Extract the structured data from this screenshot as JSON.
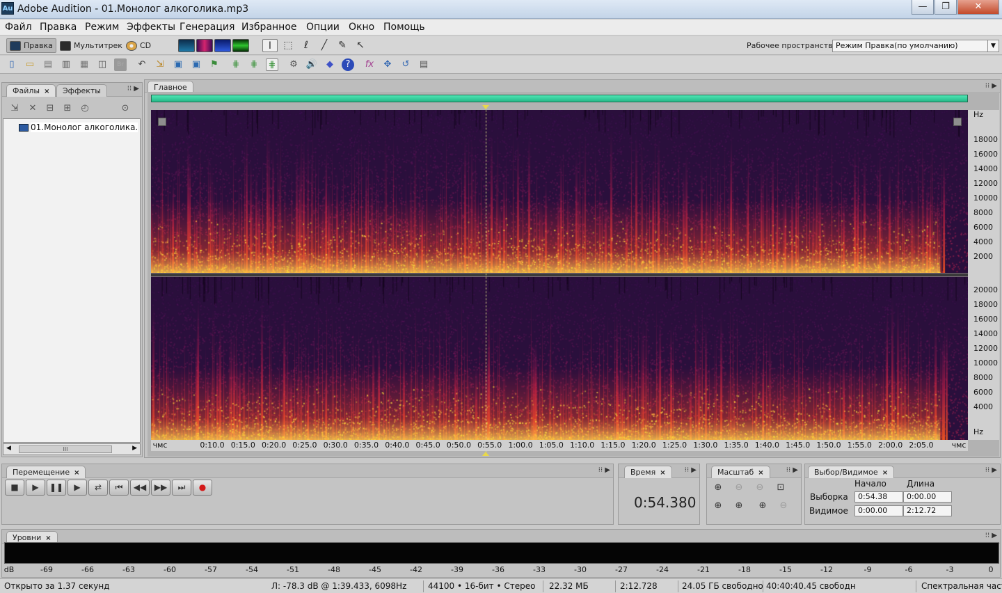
{
  "window": {
    "app_icon": "Au",
    "title": "Adobe Audition - 01.Монолог алкоголика.mp3",
    "buttons": {
      "minimize": "—",
      "maximize": "❐",
      "close": "✕"
    }
  },
  "menu": [
    "Файл",
    "Правка",
    "Режим",
    "Эффекты",
    "Генерация",
    "Избранное",
    "Опции",
    "Окно",
    "Помощь"
  ],
  "toolbar1": {
    "modes": [
      "Правка",
      "Мультитрек",
      "CD"
    ],
    "workspace_label": "Рабочее пространство:",
    "workspace_value": "Режим Правка(по умолчанию)"
  },
  "files_panel": {
    "tabs": [
      "Файлы",
      "Эффекты"
    ],
    "close": "×",
    "file_name": "01.Монолог алкоголика.",
    "scroll_grip": "III",
    "scroll_left": "◀",
    "scroll_right": "▶"
  },
  "main_panel": {
    "tab": "Главное"
  },
  "spectrogram": {
    "top_channel_labels": [
      "Hz",
      "18000",
      "16000",
      "14000",
      "12000",
      "10000",
      "8000",
      "6000",
      "4000",
      "2000"
    ],
    "bottom_channel_labels": [
      "20000",
      "18000",
      "16000",
      "14000",
      "12000",
      "10000",
      "8000",
      "6000",
      "4000",
      "Hz"
    ],
    "time_labels": [
      "чмс",
      "0:10.0",
      "0:15.0",
      "0:20.0",
      "0:25.0",
      "0:30.0",
      "0:35.0",
      "0:40.0",
      "0:45.0",
      "0:50.0",
      "0:55.0",
      "1:00.0",
      "1:05.0",
      "1:10.0",
      "1:15.0",
      "1:20.0",
      "1:25.0",
      "1:30.0",
      "1:35.0",
      "1:40.0",
      "1:45.0",
      "1:50.0",
      "1:55.0",
      "2:00.0",
      "2:05.0",
      "чмс"
    ],
    "playhead_position": "0:54.38",
    "duration": "2:12.72"
  },
  "transport": {
    "tab": "Перемещение",
    "buttons": [
      "■",
      "▶",
      "❚❚",
      "▶",
      "⇄",
      "⏮",
      "◀◀",
      "▶▶",
      "⏭",
      "●"
    ]
  },
  "time_panel": {
    "tab": "Время",
    "value": "0:54.380"
  },
  "zoom_panel": {
    "tab": "Масштаб"
  },
  "selection_panel": {
    "tab": "Выбор/Видимое",
    "col_start": "Начало",
    "col_length": "Длина",
    "row_selection": "Выборка",
    "row_view": "Видимое",
    "selection_start": "0:54.38",
    "selection_length": "0:00.00",
    "view_start": "0:00.00",
    "view_length": "2:12.72"
  },
  "levels_panel": {
    "tab": "Уровни",
    "db_labels": [
      "dB",
      "-69",
      "-66",
      "-63",
      "-60",
      "-57",
      "-54",
      "-51",
      "-48",
      "-45",
      "-42",
      "-39",
      "-36",
      "-33",
      "-30",
      "-27",
      "-24",
      "-21",
      "-18",
      "-15",
      "-12",
      "-9",
      "-6",
      "-3",
      "0"
    ]
  },
  "status": {
    "opened": "Открыто за 1.37 секунд",
    "cursor": "Л: -78.3 dB @   1:39.433, 6098Hz",
    "format": "44100 • 16-бит • Стерео",
    "size": "22.32 МБ",
    "duration": "2:12.728",
    "disk_free": "24.05 ГБ свободно",
    "time_free": "40:40:40.45 свободн",
    "view_mode": "Спектральная част"
  },
  "colors": {
    "spectro_bg": "#2a0f3c",
    "spectro_hot": "#ffd060",
    "overview": "#3ad29e",
    "playhead": "#e8e88a"
  }
}
